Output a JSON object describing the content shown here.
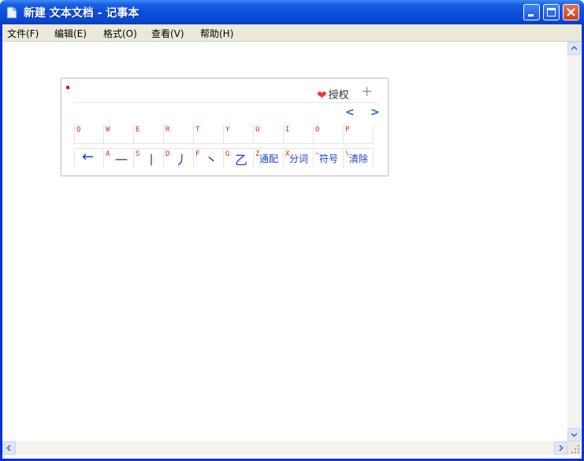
{
  "window": {
    "title": "新建 文本文档 - 记事本",
    "title_color": "#ffffff",
    "titlebar_color": "#0b4fdc"
  },
  "menu": {
    "items": [
      {
        "label": "文件(F)"
      },
      {
        "label": "编辑(E)"
      },
      {
        "label": "格式(O)"
      },
      {
        "label": "查看(V)"
      },
      {
        "label": "帮助(H)"
      }
    ]
  },
  "editor": {
    "content": ""
  },
  "ime": {
    "auth_label": "授权",
    "accent": "#1a3fd0",
    "letter_color": "#e02020",
    "top_row": [
      {
        "letter": "Q"
      },
      {
        "letter": "W"
      },
      {
        "letter": "E"
      },
      {
        "letter": "R"
      },
      {
        "letter": "T"
      },
      {
        "letter": "Y"
      },
      {
        "letter": "U"
      },
      {
        "letter": "I"
      },
      {
        "letter": "O"
      },
      {
        "letter": "P"
      }
    ],
    "bottom_row": [
      {
        "letter": "",
        "label": "←",
        "icon": "backspace-arrow-icon"
      },
      {
        "letter": "A",
        "label": "一"
      },
      {
        "letter": "S",
        "label": "丨"
      },
      {
        "letter": "D",
        "label": "丿"
      },
      {
        "letter": "F",
        "label": "丶"
      },
      {
        "letter": "G",
        "label": "乙"
      },
      {
        "letter": "Z",
        "label": "通配"
      },
      {
        "letter": "X",
        "label": "分词"
      },
      {
        "letter": "~",
        "label": "符号"
      },
      {
        "letter": "\\",
        "label": "清除"
      }
    ]
  },
  "icons": {
    "app": "notepad-icon",
    "minimize": "minimize-icon",
    "maximize": "maximize-icon",
    "close": "close-icon",
    "heart": "heart-icon",
    "plus": "plus-icon",
    "prev": "chevron-left-icon",
    "next": "chevron-right-icon"
  }
}
